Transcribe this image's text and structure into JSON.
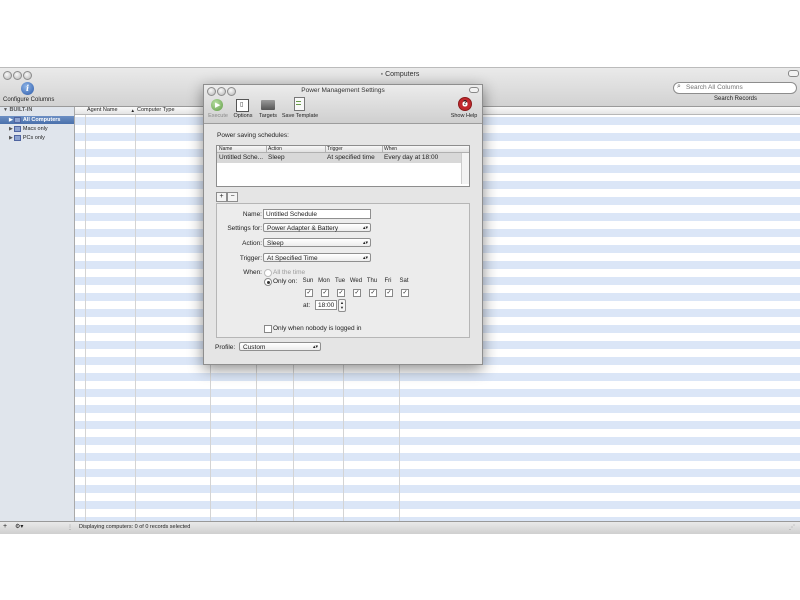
{
  "main_window": {
    "title": "Computers",
    "toolbar": {
      "configure_label": "Configure Columns",
      "configure_icon": "info-icon"
    },
    "search": {
      "placeholder": "Search All Columns",
      "label": "Search Records"
    },
    "sidebar": {
      "section": "BUILT-IN",
      "items": [
        {
          "label": "All Computers",
          "selected": true
        },
        {
          "label": "Macs only",
          "selected": false
        },
        {
          "label": "PCs only",
          "selected": false
        }
      ]
    },
    "table": {
      "columns": [
        "Agent Name",
        "Computer Type"
      ],
      "sort_indicator": "▲"
    },
    "status": "Displaying computers: 0 of 0 records selected",
    "bottom_buttons": [
      "+",
      "⚙▾"
    ]
  },
  "dialog": {
    "title": "Power Management Settings",
    "toolbar": [
      {
        "label": "Execute",
        "icon": "execute-icon",
        "enabled": false
      },
      {
        "label": "Options",
        "icon": "options-icon",
        "enabled": true
      },
      {
        "label": "Targets",
        "icon": "targets-icon",
        "enabled": true
      },
      {
        "label": "Save Template",
        "icon": "save-template-icon",
        "enabled": true
      }
    ],
    "help": {
      "label": "Show Help",
      "icon": "help-icon"
    },
    "schedules_label": "Power saving schedules:",
    "schedule_columns": [
      "Name",
      "Action",
      "Trigger",
      "When"
    ],
    "schedule_row": {
      "name": "Untitled Sche...",
      "action": "Sleep",
      "trigger": "At specified time",
      "when": "Every day at 18:00"
    },
    "add_button": "+",
    "remove_button": "−",
    "form": {
      "name_label": "Name:",
      "name_value": "Untitled Schedule",
      "settings_for_label": "Settings for:",
      "settings_for_value": "Power Adapter & Battery",
      "action_label": "Action:",
      "action_value": "Sleep",
      "trigger_label": "Trigger:",
      "trigger_value": "At Specified Time",
      "when_label": "When:",
      "all_the_time": "All the time",
      "only_on": "Only on:",
      "days": [
        "Sun",
        "Mon",
        "Tue",
        "Wed",
        "Thu",
        "Fri",
        "Sat"
      ],
      "days_checked": [
        true,
        true,
        true,
        true,
        true,
        true,
        true
      ],
      "at_label": "at:",
      "time_value": "18:00",
      "nobody_logged_in": "Only when nobody is logged in"
    },
    "profile_label": "Profile:",
    "profile_value": "Custom"
  }
}
